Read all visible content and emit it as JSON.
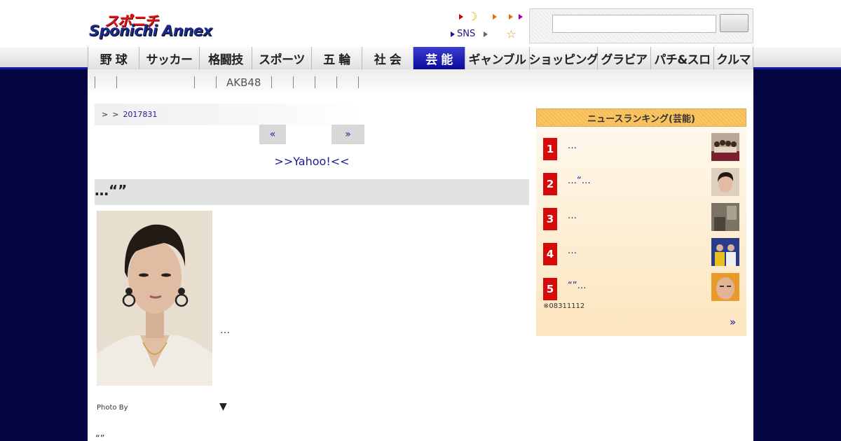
{
  "logo": {
    "top_text": "スポニチ",
    "main_text": "Sponichi Annex"
  },
  "header_links": {
    "sns_label": "SNS"
  },
  "search": {
    "placeholder": ""
  },
  "nav": {
    "items": [
      {
        "label": "野 球"
      },
      {
        "label": "サッカー"
      },
      {
        "label": "格闘技"
      },
      {
        "label": "スポーツ"
      },
      {
        "label": "五 輪"
      },
      {
        "label": "社 会"
      },
      {
        "label": "芸 能",
        "active": true
      },
      {
        "label": "ギャンブル"
      },
      {
        "label": "ショッピング"
      },
      {
        "label": "グラビア"
      },
      {
        "label": "パチ&スロ"
      },
      {
        "label": "クルマ"
      }
    ]
  },
  "subnav": {
    "label": "AKB48"
  },
  "breadcrumb": {
    "sep1": ">",
    "sep2": ">",
    "date": "2017831"
  },
  "pager": {
    "prev": "«",
    "next": "»"
  },
  "yahoo_link": ">>Yahoo!<<",
  "article": {
    "headline": "…“”",
    "caption": "…",
    "photo_by": "Photo By",
    "more_arrow": "▼",
    "body_start": "“”"
  },
  "ranking": {
    "title": "ニュースランキング(芸能)",
    "items": [
      {
        "rank": "1",
        "title": "…"
      },
      {
        "rank": "2",
        "title": "…“…"
      },
      {
        "rank": "3",
        "title": "…"
      },
      {
        "rank": "4",
        "title": "…"
      },
      {
        "rank": "5",
        "title": "“”…"
      }
    ],
    "note": "※08311112",
    "more": "»"
  },
  "colors": {
    "background": "#060642",
    "nav_active": "#0a0a9a",
    "rank_badge": "#d70a0a",
    "link": "#1a1a99"
  }
}
